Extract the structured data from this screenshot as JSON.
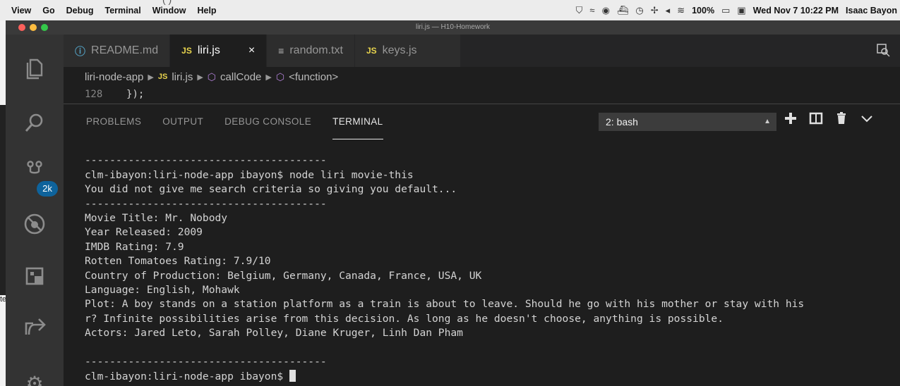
{
  "menubar": {
    "items": [
      "View",
      "Go",
      "Debug",
      "Terminal",
      "Window",
      "Help"
    ],
    "status_left": "100%",
    "datetime": "Wed Nov 7 10:22 PM",
    "user": "Isaac Bayon",
    "partial_text": "(                   )"
  },
  "left_strip_text": "te",
  "window": {
    "title": "liri.js — H10-Homework"
  },
  "activity": {
    "badge": "2k"
  },
  "tabs": [
    {
      "icon": "ⓘ",
      "label": "README.md"
    },
    {
      "icon": "JS",
      "label": "liri.js",
      "close": "×"
    },
    {
      "icon": "≡",
      "label": "random.txt"
    },
    {
      "icon": "JS",
      "label": "keys.js"
    }
  ],
  "breadcrumb": {
    "folder": "liri-node-app",
    "file": "liri.js",
    "symbol1": "callCode",
    "symbol2": "<function>",
    "js_badge": "JS"
  },
  "code": {
    "line_number": "128",
    "text": "});"
  },
  "panel": {
    "tabs": [
      "PROBLEMS",
      "OUTPUT",
      "DEBUG CONSOLE",
      "TERMINAL"
    ],
    "terminal_select": "2: bash"
  },
  "terminal": {
    "lines": [
      "",
      "---------------------------------------",
      "clm-ibayon:liri-node-app ibayon$ node liri movie-this",
      "You did not give me search criteria so giving you default...",
      "---------------------------------------",
      "Movie Title: Mr. Nobody",
      "Year Released: 2009",
      "IMDB Rating: 7.9",
      "Rotten Tomatoes Rating: 7.9/10",
      "Country of Production: Belgium, Germany, Canada, France, USA, UK",
      "Language: English, Mohawk",
      "Plot: A boy stands on a station platform as a train is about to leave. Should he go with his mother or stay with his",
      "r? Infinite possibilities arise from this decision. As long as he doesn't choose, anything is possible.",
      "Actors: Jared Leto, Sarah Polley, Diane Kruger, Linh Dan Pham",
      "",
      "---------------------------------------"
    ],
    "prompt": "clm-ibayon:liri-node-app ibayon$ "
  },
  "colors": {
    "badge": "#0e639c",
    "js_icon": "#e8d44d",
    "red_light": "#fc605b",
    "yellow_light": "#fdbc40",
    "green_light": "#34c84a"
  }
}
